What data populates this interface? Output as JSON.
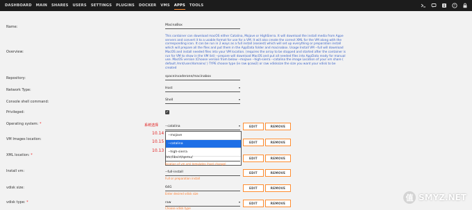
{
  "nav": {
    "tabs": [
      "DASHBOARD",
      "MAIN",
      "SHARES",
      "USERS",
      "SETTINGS",
      "PLUGINS",
      "DOCKER",
      "VMS",
      "APPS",
      "TOOLS"
    ],
    "active": "APPS"
  },
  "icons": [
    "terminal-icon",
    "feedback-icon",
    "info-icon",
    "help-icon",
    "lock-icon"
  ],
  "form": {
    "name": {
      "label": "Name:",
      "value": "MacinaBox"
    },
    "overview": {
      "label": "Overview:",
      "text": "This container can download macOS either Catalina, Mojave or HighSierra. It will download the install media from Appe servers and convert it to a usable format for use for a VM. It will also create the correct XML for the VM along with the corresponding icon. It can be run in 2 ways as a full install (easiest) which will set up everything or preparation install which will prepare all the files and put them in the AppData folder and macinabox. Usage Install VM --full will download MacOS and install needed files into your VM location. (requires the array to be stopped and started after the container is run for VM to show in the VM list) --prepare will download MacOS and put all needed files into AppData ready for manual use. MacOS version (Choose version from below --mojave --high-sierra --catalina the image Location of your vm share ( default /mnt/user/domains/ ) TYPE choose type (ie raw qcow2) or raw vdisksize the size you want your vdisk to be created"
    },
    "repository": {
      "label": "Repository:",
      "value": "spaceinvaderone/macinabox"
    },
    "network": {
      "label": "Network Type:",
      "value": "Host"
    },
    "console": {
      "label": "Console shell command:",
      "value": "Shell"
    },
    "privileged": {
      "label": "Privileged:"
    },
    "os": {
      "label": "Operating system:",
      "value": "--catalina"
    },
    "vmimages": {
      "label": "VM Images location:"
    },
    "xml": {
      "label": "XML location:",
      "value": "/etc/libvirt/qemu/",
      "hint": "location of vm xml templates (host change)"
    },
    "install": {
      "label": "Install vm:",
      "value": "--full-install",
      "hint": "Full or preparation install"
    },
    "vdisksize": {
      "label": "vdisk size:",
      "value": "64G",
      "hint": "Enter desired vdisk size"
    },
    "vdisktype": {
      "label": "vdisk type:",
      "value": "raw",
      "hint": "Choose vdisk type"
    },
    "required_mark": "*"
  },
  "buttons": {
    "edit": "EDIT",
    "remove": "REMOVE"
  },
  "dropdown": {
    "options": [
      "--mojave",
      "--catalina",
      "--high-sierra"
    ],
    "selected": "--catalina"
  },
  "annotations": {
    "title": "系统选择",
    "labels": [
      "10.14",
      "10.15",
      "10.13"
    ]
  },
  "watermark": {
    "badge": "值",
    "text": "SMYZ.NET"
  },
  "colors": {
    "accent": "#ff8c2f",
    "topbar": "#1c1c1c",
    "select": "#1e6fe6",
    "annotation": "#e02020",
    "description": "#3b63c8"
  }
}
